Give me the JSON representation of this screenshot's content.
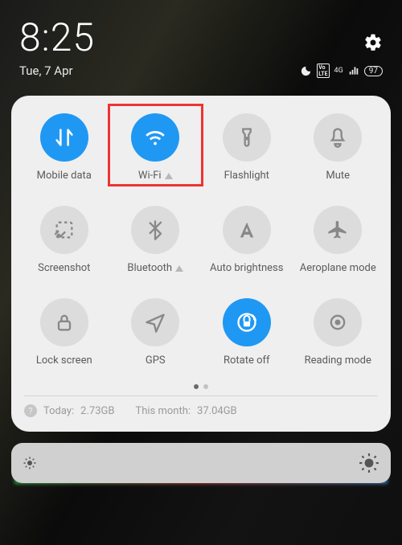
{
  "header": {
    "time": "8:25",
    "date": "Tue, 7 Apr",
    "battery": "97"
  },
  "tiles": [
    {
      "id": "mobile-data",
      "label": "Mobile data",
      "active": true,
      "expandable": false
    },
    {
      "id": "wifi",
      "label": "Wi-Fi",
      "active": true,
      "expandable": true
    },
    {
      "id": "flashlight",
      "label": "Flashlight",
      "active": false,
      "expandable": false
    },
    {
      "id": "mute",
      "label": "Mute",
      "active": false,
      "expandable": false
    },
    {
      "id": "screenshot",
      "label": "Screenshot",
      "active": false,
      "expandable": false
    },
    {
      "id": "bluetooth",
      "label": "Bluetooth",
      "active": false,
      "expandable": true
    },
    {
      "id": "auto-brightness",
      "label": "Auto brightness",
      "active": false,
      "expandable": false
    },
    {
      "id": "aeroplane-mode",
      "label": "Aeroplane mode",
      "active": false,
      "expandable": false
    },
    {
      "id": "lock-screen",
      "label": "Lock screen",
      "active": false,
      "expandable": false
    },
    {
      "id": "gps",
      "label": "GPS",
      "active": false,
      "expandable": false
    },
    {
      "id": "rotate-off",
      "label": "Rotate off",
      "active": true,
      "expandable": false
    },
    {
      "id": "reading-mode",
      "label": "Reading mode",
      "active": false,
      "expandable": false
    }
  ],
  "usage": {
    "today_label": "Today:",
    "today_value": "2.73GB",
    "month_label": "This month:",
    "month_value": "37.04GB"
  },
  "highlight_tile": "wifi"
}
